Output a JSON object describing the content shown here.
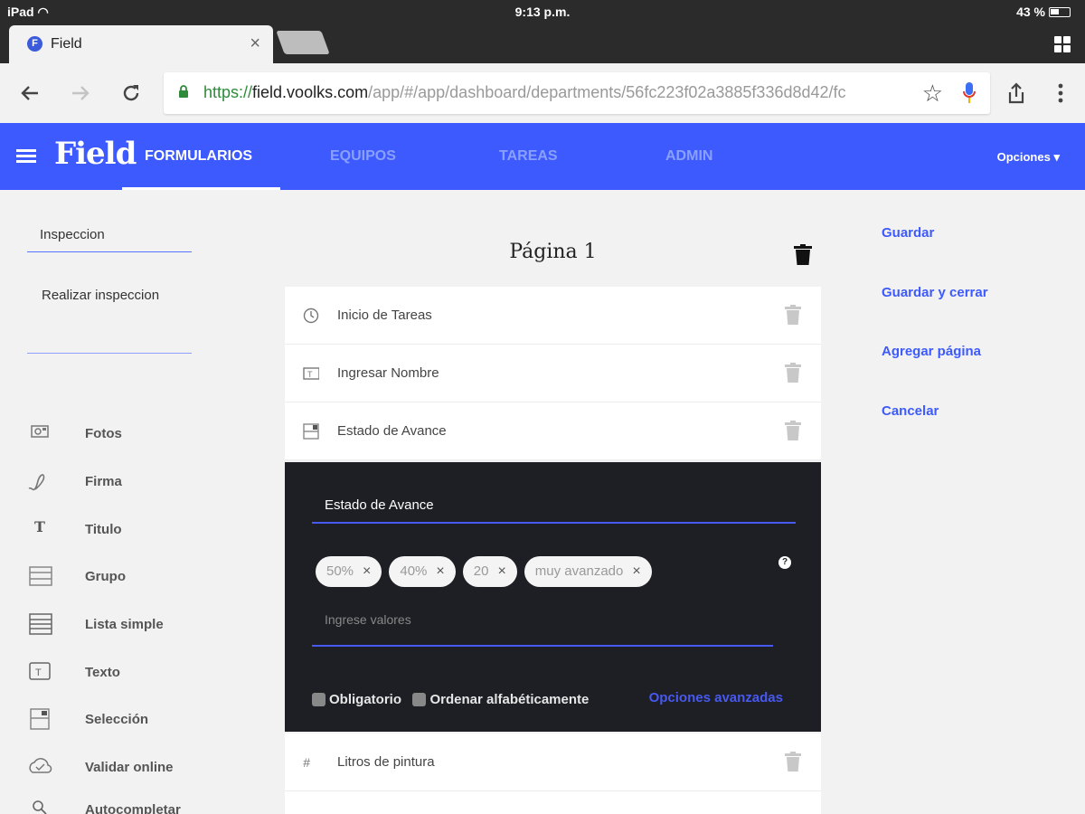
{
  "status_bar": {
    "device": "iPad",
    "time": "9:13 p.m.",
    "battery": "43 %"
  },
  "browser": {
    "tab_title": "Field",
    "url_scheme": "https://",
    "url_host": "field.voolks.com",
    "url_path": "/app/#/app/dashboard/departments/56fc223f02a3885f336d8d42/fc",
    "icons": [
      "back-icon",
      "forward-icon",
      "reload-icon",
      "lock-icon",
      "star-icon",
      "mic-icon",
      "share-icon",
      "more-icon",
      "tab-switcher-icon"
    ]
  },
  "app": {
    "logo": "Field",
    "nav": [
      "FORMULARIOS",
      "EQUIPOS",
      "TAREAS",
      "ADMIN"
    ],
    "active_nav": "FORMULARIOS",
    "options": "Opciones",
    "accent_color": "#3d5afe"
  },
  "sidebar": {
    "form_name": "Inspeccion",
    "form_description": "Realizar inspeccion",
    "tools": [
      {
        "label": "Fotos",
        "icon": "photos-icon"
      },
      {
        "label": "Firma",
        "icon": "signature-icon"
      },
      {
        "label": "Titulo",
        "icon": "title-icon"
      },
      {
        "label": "Grupo",
        "icon": "group-icon"
      },
      {
        "label": "Lista simple",
        "icon": "list-icon"
      },
      {
        "label": "Texto",
        "icon": "text-icon"
      },
      {
        "label": "Selección",
        "icon": "selection-icon"
      },
      {
        "label": "Validar online",
        "icon": "validate-icon"
      },
      {
        "label": "Autocompletar",
        "icon": "search-icon"
      }
    ]
  },
  "page": {
    "title": "Página 1",
    "fields": [
      {
        "label": "Inicio de Tareas",
        "icon": "clock-icon"
      },
      {
        "label": "Ingresar Nombre",
        "icon": "text-field-icon"
      },
      {
        "label": "Estado de Avance",
        "icon": "select-field-icon"
      }
    ],
    "editor": {
      "name": "Estado de Avance",
      "chips": [
        "50%",
        "40%",
        "20",
        "muy avanzado"
      ],
      "values_placeholder": "Ingrese valores",
      "required_label": "Obligatorio",
      "sort_label": "Ordenar alfabéticamente",
      "advanced_label": "Opciones avanzadas"
    },
    "fields_after": [
      {
        "label": "Litros de pintura",
        "icon": "number-icon"
      }
    ]
  },
  "actions": [
    "Guardar",
    "Guardar y cerrar",
    "Agregar página",
    "Cancelar"
  ]
}
